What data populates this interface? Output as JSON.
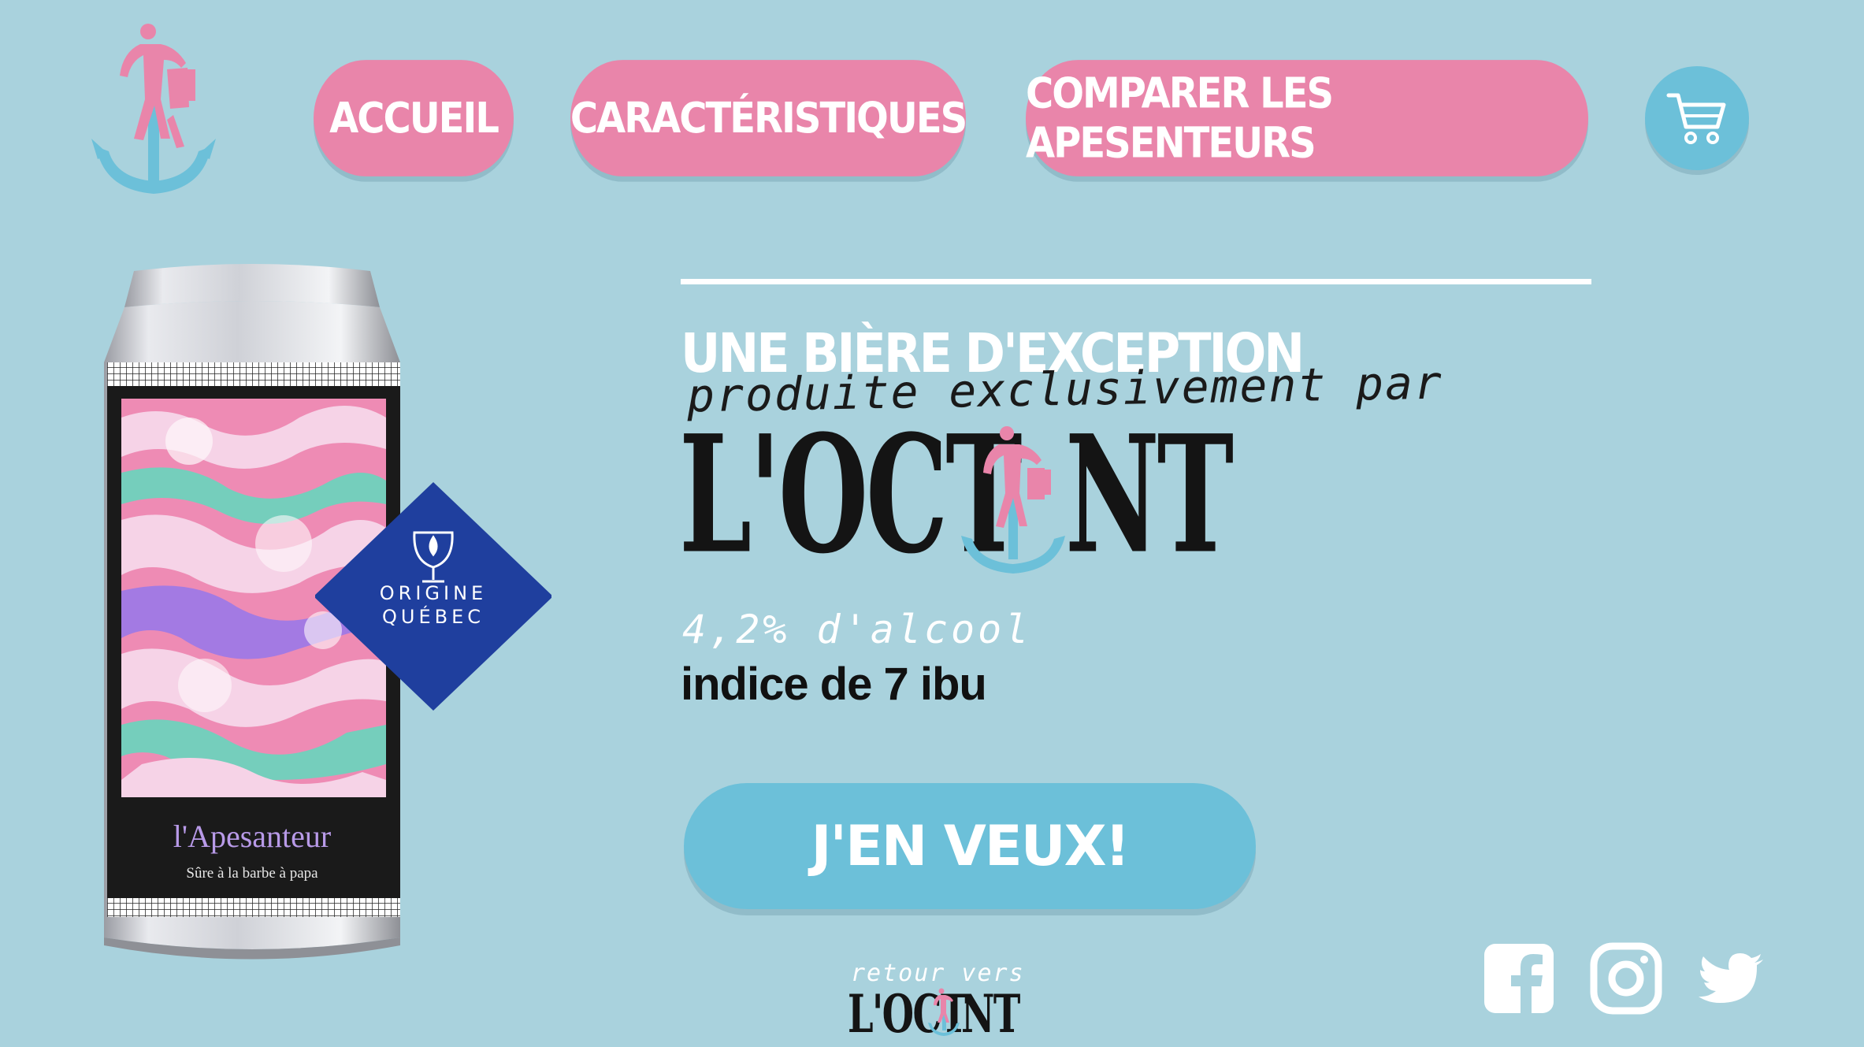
{
  "colors": {
    "background": "#a9d2dd",
    "pink": "#e985aa",
    "blue": "#6cc0d9",
    "navy_badge": "#1f3f9e",
    "white": "#ffffff",
    "ink": "#141414"
  },
  "logo": {
    "icon": "anchor-rocking-horse-logo-icon"
  },
  "nav": {
    "items": [
      {
        "label": "ACCUEIL"
      },
      {
        "label": "CARACTÉRISTIQUES"
      },
      {
        "label": "COMPARER LES APESENTEURS"
      }
    ],
    "cart_icon": "shopping-cart-icon"
  },
  "hero": {
    "headline": "UNE BIÈRE D'EXCEPTION",
    "subline": "produite exclusivement par",
    "brand_left": "L'OCT",
    "brand_right": "NT",
    "abv": "4,2% d'alcool",
    "ibu": "indice de 7 ibu",
    "cta_label": "J'EN VEUX!"
  },
  "product": {
    "name": "l'Apesanteur",
    "tagline": "Sûre à la barbe à papa",
    "badge_line1": "ORIGINE",
    "badge_line2": "QUÉBEC"
  },
  "footer": {
    "back_small": "retour vers",
    "back_brand_left": "L'OCT",
    "back_brand_right": "NT",
    "social_icons": [
      "facebook-icon",
      "instagram-icon",
      "twitter-icon"
    ]
  }
}
